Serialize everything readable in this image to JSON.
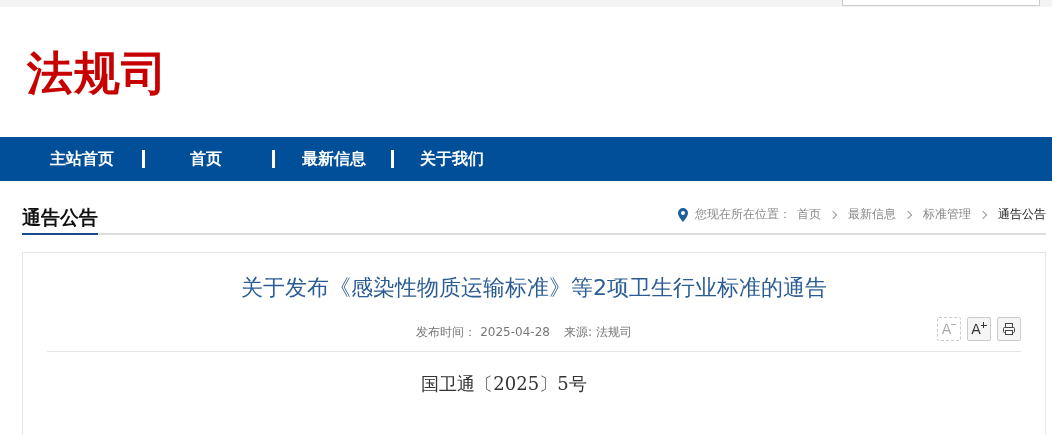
{
  "site_title": "法规司",
  "nav": [
    {
      "label": "主站首页"
    },
    {
      "label": "首页"
    },
    {
      "label": "最新信息"
    },
    {
      "label": "关于我们"
    }
  ],
  "section_title": "通告公告",
  "breadcrumb": {
    "prefix": "您现在所在位置：",
    "items": [
      "首页",
      "最新信息",
      "标准管理",
      "通告公告"
    ]
  },
  "article": {
    "title": "关于发布《感染性物质运输标准》等2项卫生行业标准的通告",
    "publish_label": "发布时间：",
    "date": "2025-04-28",
    "source": "来源: 法规司",
    "tools": [
      {
        "kind": "smaller",
        "label": "A",
        "disabled": true
      },
      {
        "kind": "larger",
        "label": "A",
        "disabled": false
      },
      {
        "kind": "print"
      }
    ],
    "doc_number": "国卫通〔2025〕5号"
  }
}
